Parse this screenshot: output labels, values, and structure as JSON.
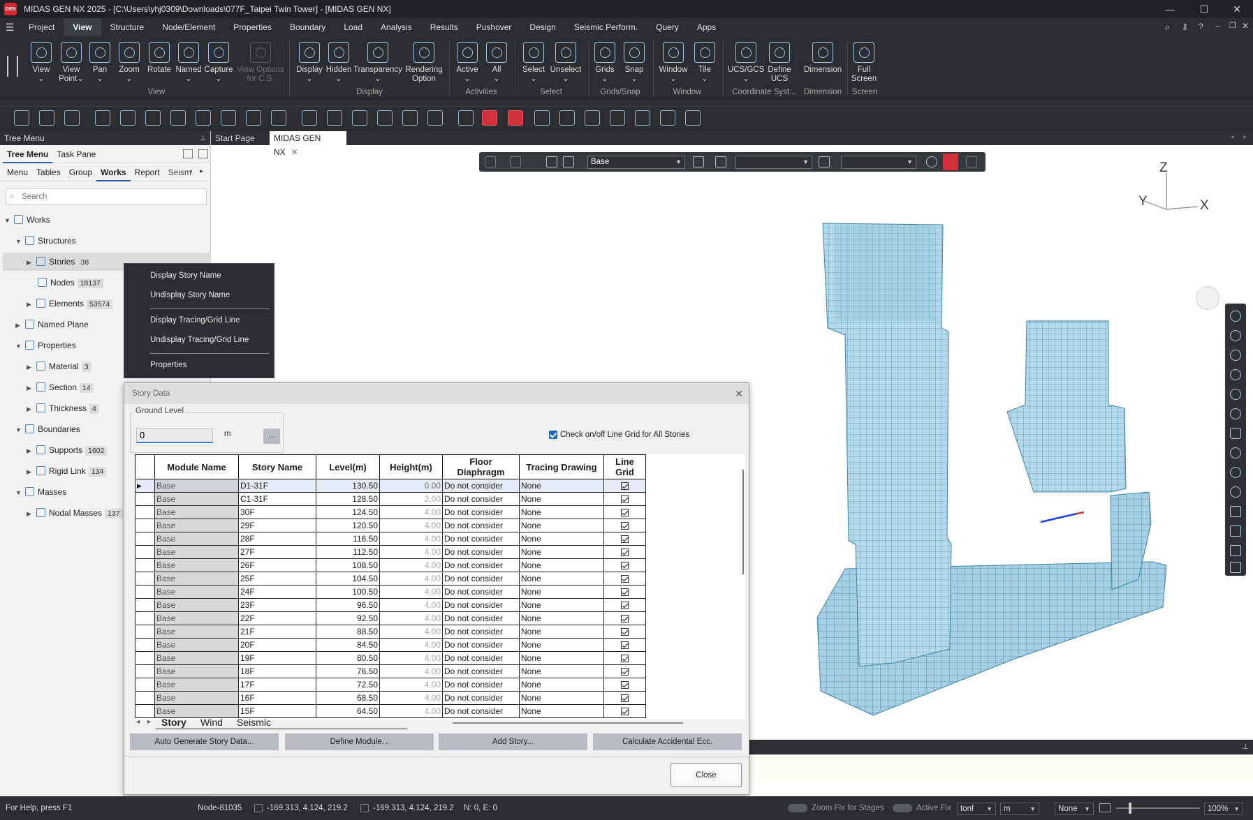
{
  "app": {
    "title": "MIDAS GEN NX 2025 - [C:\\Users\\yhj0309\\Downloads\\077F_Taipei Twin Tower] - [MIDAS GEN NX]",
    "logo_text": "GEN"
  },
  "menu": [
    "Project",
    "View",
    "Structure",
    "Node/Element",
    "Properties",
    "Boundary",
    "Load",
    "Analysis",
    "Results",
    "Pushover",
    "Design",
    "Seismic Perform.",
    "Query",
    "Apps"
  ],
  "ribbon": {
    "buttons": [
      {
        "label": "View",
        "sub": "⌄"
      },
      {
        "label": "View",
        "sub": "Point⌄"
      },
      {
        "label": "Pan",
        "sub": "⌄"
      },
      {
        "label": "Zoom",
        "sub": "⌄"
      },
      {
        "label": "Rotate",
        "sub": ""
      },
      {
        "label": "Named",
        "sub": "⌄"
      },
      {
        "label": "Capture",
        "sub": "⌄"
      },
      {
        "label": "View Options",
        "sub": "for C.S."
      },
      {
        "label": "Display",
        "sub": "⌄"
      },
      {
        "label": "Hidden",
        "sub": "⌄"
      },
      {
        "label": "Transparency",
        "sub": "⌄"
      },
      {
        "label": "Rendering",
        "sub": "Option"
      },
      {
        "label": "Active",
        "sub": "⌄"
      },
      {
        "label": "All",
        "sub": "⌄"
      },
      {
        "label": "Select",
        "sub": "⌄"
      },
      {
        "label": "Unselect",
        "sub": "⌄"
      },
      {
        "label": "Grids",
        "sub": "⌄"
      },
      {
        "label": "Snap",
        "sub": "⌄"
      },
      {
        "label": "Window",
        "sub": "⌄"
      },
      {
        "label": "Tile",
        "sub": "⌄"
      },
      {
        "label": "UCS/GCS",
        "sub": "⌄"
      },
      {
        "label": "Define",
        "sub": "UCS"
      },
      {
        "label": "Dimension",
        "sub": ""
      },
      {
        "label": "Full",
        "sub": "Screen"
      }
    ],
    "groups": [
      "View",
      "Display",
      "Activities",
      "Select",
      "Grids/Snap",
      "Window",
      "Coordinate Syst...",
      "Dimension",
      "Screen"
    ]
  },
  "tree": {
    "panel_title": "Tree Menu",
    "top_tabs": [
      "Tree Menu",
      "Task Pane"
    ],
    "sub_tabs": [
      "Menu",
      "Tables",
      "Group",
      "Works",
      "Report",
      "Seism"
    ],
    "search_placeholder": "Search",
    "nodes": [
      {
        "label": "Works",
        "count": ""
      },
      {
        "label": "Structures",
        "count": ""
      },
      {
        "label": "Stories",
        "count": "38"
      },
      {
        "label": "Nodes",
        "count": "18137"
      },
      {
        "label": "Elements",
        "count": "53574"
      },
      {
        "label": "Named Plane",
        "count": ""
      },
      {
        "label": "Properties",
        "count": ""
      },
      {
        "label": "Material",
        "count": "3"
      },
      {
        "label": "Section",
        "count": "14"
      },
      {
        "label": "Thickness",
        "count": "4"
      },
      {
        "label": "Boundaries",
        "count": ""
      },
      {
        "label": "Supports",
        "count": "1602"
      },
      {
        "label": "Rigid Link",
        "count": "134"
      },
      {
        "label": "Masses",
        "count": ""
      },
      {
        "label": "Nodal Masses",
        "count": "137"
      }
    ]
  },
  "context_menu": [
    "Display Story Name",
    "Undisplay Story Name",
    "Display Tracing/Grid Line",
    "Undisplay Tracing/Grid Line",
    "Properties"
  ],
  "doc_tabs": [
    "Start Page",
    "MIDAS GEN NX"
  ],
  "view_toolbar": {
    "story_select": "Base",
    "select2": "",
    "select3": ""
  },
  "axes": {
    "z": "Z",
    "y": "Y",
    "x": "X"
  },
  "dialog": {
    "title": "Story Data",
    "ground_level_label": "Ground Level",
    "ground_level_value": "0",
    "ground_level_unit": "m",
    "ground_btn": "...",
    "check_label": "Check on/off Line Grid for All Stories",
    "columns": [
      "Module Name",
      "Story Name",
      "Level(m)",
      "Height(m)",
      "Floor\nDiaphragm",
      "Tracing Drawing",
      "Line\nGrid"
    ],
    "rows": [
      {
        "module": "Base",
        "story": "D1-31F",
        "level": "130.50",
        "height": "0.00",
        "diaphragm": "Do not consider",
        "tracing": "None"
      },
      {
        "module": "Base",
        "story": "C1-31F",
        "level": "128.50",
        "height": "2.00",
        "diaphragm": "Do not consider",
        "tracing": "None"
      },
      {
        "module": "Base",
        "story": "30F",
        "level": "124.50",
        "height": "4.00",
        "diaphragm": "Do not consider",
        "tracing": "None"
      },
      {
        "module": "Base",
        "story": "29F",
        "level": "120.50",
        "height": "4.00",
        "diaphragm": "Do not consider",
        "tracing": "None"
      },
      {
        "module": "Base",
        "story": "28F",
        "level": "116.50",
        "height": "4.00",
        "diaphragm": "Do not consider",
        "tracing": "None"
      },
      {
        "module": "Base",
        "story": "27F",
        "level": "112.50",
        "height": "4.00",
        "diaphragm": "Do not consider",
        "tracing": "None"
      },
      {
        "module": "Base",
        "story": "26F",
        "level": "108.50",
        "height": "4.00",
        "diaphragm": "Do not consider",
        "tracing": "None"
      },
      {
        "module": "Base",
        "story": "25F",
        "level": "104.50",
        "height": "4.00",
        "diaphragm": "Do not consider",
        "tracing": "None"
      },
      {
        "module": "Base",
        "story": "24F",
        "level": "100.50",
        "height": "4.00",
        "diaphragm": "Do not consider",
        "tracing": "None"
      },
      {
        "module": "Base",
        "story": "23F",
        "level": "96.50",
        "height": "4.00",
        "diaphragm": "Do not consider",
        "tracing": "None"
      },
      {
        "module": "Base",
        "story": "22F",
        "level": "92.50",
        "height": "4.00",
        "diaphragm": "Do not consider",
        "tracing": "None"
      },
      {
        "module": "Base",
        "story": "21F",
        "level": "88.50",
        "height": "4.00",
        "diaphragm": "Do not consider",
        "tracing": "None"
      },
      {
        "module": "Base",
        "story": "20F",
        "level": "84.50",
        "height": "4.00",
        "diaphragm": "Do not consider",
        "tracing": "None"
      },
      {
        "module": "Base",
        "story": "19F",
        "level": "80.50",
        "height": "4.00",
        "diaphragm": "Do not consider",
        "tracing": "None"
      },
      {
        "module": "Base",
        "story": "18F",
        "level": "76.50",
        "height": "4.00",
        "diaphragm": "Do not consider",
        "tracing": "None"
      },
      {
        "module": "Base",
        "story": "17F",
        "level": "72.50",
        "height": "4.00",
        "diaphragm": "Do not consider",
        "tracing": "None"
      },
      {
        "module": "Base",
        "story": "16F",
        "level": "68.50",
        "height": "4.00",
        "diaphragm": "Do not consider",
        "tracing": "None"
      },
      {
        "module": "Base",
        "story": "15F",
        "level": "64.50",
        "height": "4.00",
        "diaphragm": "Do not consider",
        "tracing": "None"
      }
    ],
    "sheet_tabs": [
      "Story",
      "Wind",
      "Seismic"
    ],
    "buttons": [
      "Auto Generate Story Data...",
      "Define Module...",
      "Add Story...",
      "Calculate Accidental Ecc."
    ],
    "close_label": "Close"
  },
  "status": {
    "help": "For Help, press F1",
    "node": "Node-81035",
    "coord1": "-169.313, 4.124, 219.2",
    "coord2": "-169.313, 4.124, 219.2",
    "ne": "N: 0, E: 0",
    "zoom_fix": "Zoom Fix for Stages",
    "active_fix": "Active Fix",
    "force_unit": "tonf",
    "length_unit": "m",
    "none_select": "None",
    "zoom_level": "100%"
  }
}
